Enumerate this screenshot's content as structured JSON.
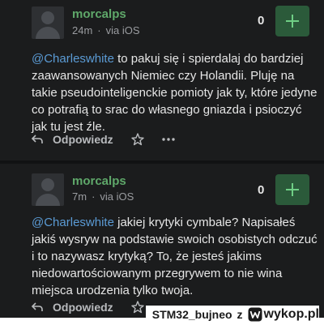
{
  "comments": [
    {
      "username": "morcalps",
      "time": "24m",
      "separator": "·",
      "source": "via iOS",
      "votes": "0",
      "mention": "@Charleswhite",
      "body": " to pakuj się i spierdalaj do bardziej zaawansowanych Niemiec czy Holandii. Pluję na takie pseudointeligenckie pomioty jak ty, które jedyne co potrafią to srac do własnego gniazda i psioczyć jak tu jest źle.",
      "reply_label": "Odpowiedz"
    },
    {
      "username": "morcalps",
      "time": "7m",
      "separator": "·",
      "source": "via iOS",
      "votes": "0",
      "mention": "@Charleswhite",
      "body": " jakiej krytyki cymbale? Napisałeś jakiś wysryw na podstawie swoich osobistych odczuć i to nazywasz krytyką? To, że jesteś jakims niedowartościowanym przegrywem to nie wina miejsca urodzenia tylko twoja.",
      "reply_label": "Odpowiedz"
    }
  ],
  "watermark": {
    "author": "STM32_bujneo",
    "via": "z",
    "site": "wykop.pl"
  },
  "colors": {
    "background": "#1b1c1d",
    "username": "#5fa86a",
    "mention": "#5b9bd5",
    "plus_button": "#2b5a3a"
  },
  "icons": [
    "avatar-placeholder-icon",
    "plus-icon",
    "reply-icon",
    "star-icon",
    "more-icon",
    "wykop-logo-icon"
  ]
}
